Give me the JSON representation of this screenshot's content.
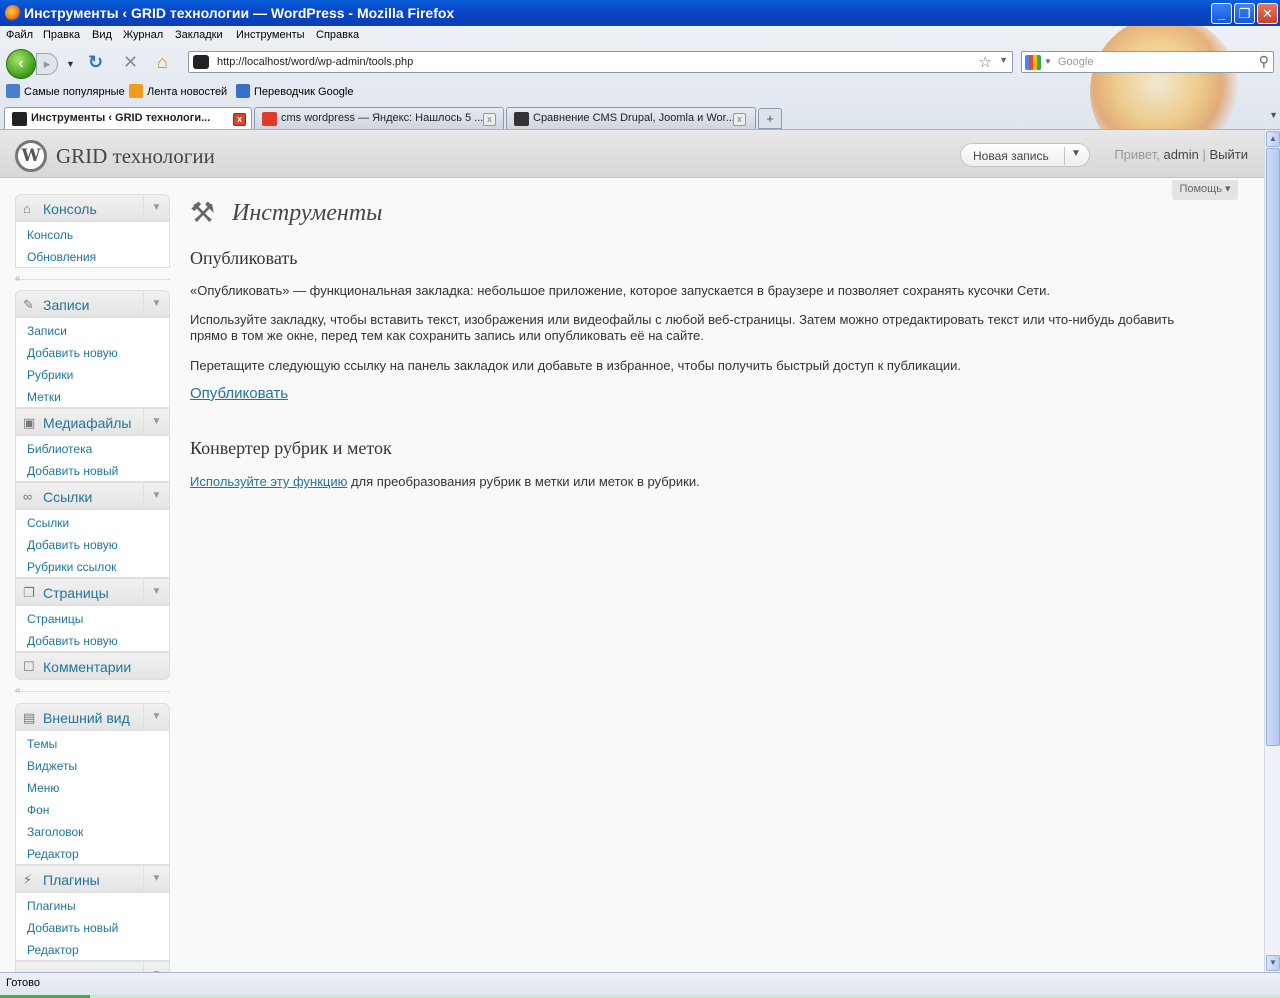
{
  "window": {
    "title": "Инструменты ‹ GRID технологии — WordPress - Mozilla Firefox",
    "controls": [
      "_",
      "❐",
      "✕"
    ]
  },
  "menubar": [
    "Файл",
    "Правка",
    "Вид",
    "Журнал",
    "Закладки",
    "Инструменты",
    "Справка"
  ],
  "navbar": {
    "url": "http://localhost/word/wp-admin/tools.php",
    "search_placeholder": "Google"
  },
  "bookmarks": [
    "Самые популярные",
    "Лента новостей",
    "Переводчик Google"
  ],
  "tabs": [
    {
      "label": "Инструменты ‹ GRID технологи...",
      "active": true
    },
    {
      "label": "cms wordpress — Яндекс: Нашлось 5 ...",
      "active": false
    },
    {
      "label": "Сравнение CMS Drupal, Joomla и Wor...",
      "active": false
    }
  ],
  "wp": {
    "site_name": "GRID технологии",
    "favorite_action": "Новая запись",
    "greeting": "Привет,",
    "user": "admin",
    "logout": "Выйти",
    "help": "Помощь"
  },
  "menu": [
    {
      "label": "Консоль",
      "icon": "home-icon",
      "items": [
        "Консоль",
        "Обновления"
      ]
    },
    {
      "label": "Записи",
      "icon": "pin-icon",
      "items": [
        "Записи",
        "Добавить новую",
        "Рубрики",
        "Метки"
      ]
    },
    {
      "label": "Медиафайлы",
      "icon": "media-icon",
      "items": [
        "Библиотека",
        "Добавить новый"
      ]
    },
    {
      "label": "Ссылки",
      "icon": "link-icon",
      "items": [
        "Ссылки",
        "Добавить новую",
        "Рубрики ссылок"
      ]
    },
    {
      "label": "Страницы",
      "icon": "pages-icon",
      "items": [
        "Страницы",
        "Добавить новую"
      ]
    },
    {
      "label": "Комментарии",
      "icon": "comments-icon",
      "items": []
    },
    {
      "label": "Внешний вид",
      "icon": "appearance-icon",
      "items": [
        "Темы",
        "Виджеты",
        "Меню",
        "Фон",
        "Заголовок",
        "Редактор"
      ]
    },
    {
      "label": "Плагины",
      "icon": "plugins-icon",
      "items": [
        "Плагины",
        "Добавить новый",
        "Редактор"
      ]
    }
  ],
  "content": {
    "title": "Инструменты",
    "press_this": {
      "heading": "Опубликовать",
      "p1": "«Опубликовать» — функциональная закладка: небольшое приложение, которое запускается в браузере и позволяет сохранять кусочки Сети.",
      "p2": "Используйте закладку, чтобы вставить текст, изображения или видеофайлы с любой веб-страницы. Затем можно отредактировать текст или что-нибудь добавить прямо в том же окне, перед тем как сохранить запись или опубликовать её на сайте.",
      "p3": "Перетащите следующую ссылку на панель закладок или добавьте в избранное, чтобы получить быстрый доступ к публикации.",
      "link": "Опубликовать"
    },
    "converter": {
      "heading": "Конвертер рубрик и меток",
      "link": "Используйте эту функцию",
      "text": " для преобразования рубрик в метки или меток в рубрики."
    }
  },
  "status": "Готово"
}
